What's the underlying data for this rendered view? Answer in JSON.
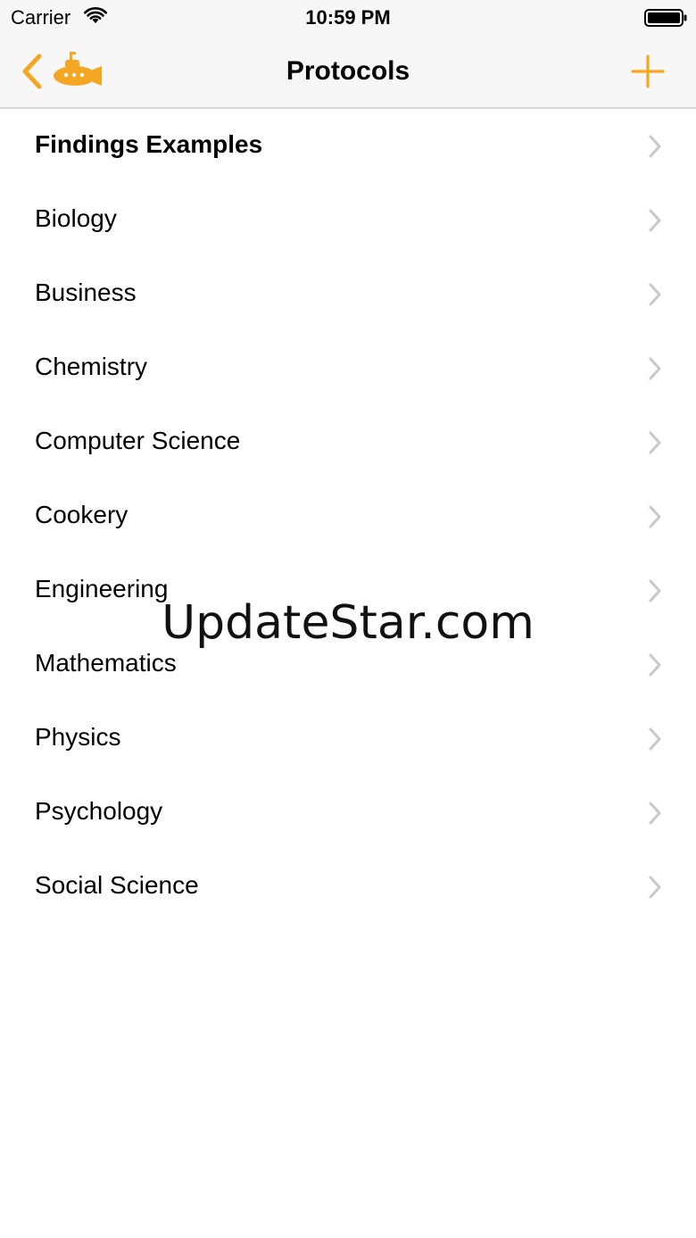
{
  "status_bar": {
    "carrier": "Carrier",
    "time": "10:59 PM",
    "wifi_icon": "wifi-icon",
    "battery_icon": "battery-icon"
  },
  "nav": {
    "title": "Protocols",
    "back_icon": "chevron-left-icon",
    "logo_icon": "submarine-icon",
    "add_icon": "plus-icon",
    "accent_color": "#f5a623"
  },
  "list": {
    "items": [
      {
        "label": "Findings Examples",
        "bold": true
      },
      {
        "label": "Biology"
      },
      {
        "label": "Business"
      },
      {
        "label": "Chemistry"
      },
      {
        "label": "Computer Science"
      },
      {
        "label": "Cookery"
      },
      {
        "label": "Engineering"
      },
      {
        "label": "Mathematics"
      },
      {
        "label": "Physics"
      },
      {
        "label": "Psychology"
      },
      {
        "label": "Social Science"
      }
    ],
    "disclosure_icon": "chevron-right-icon"
  },
  "watermark": "UpdateStar.com"
}
